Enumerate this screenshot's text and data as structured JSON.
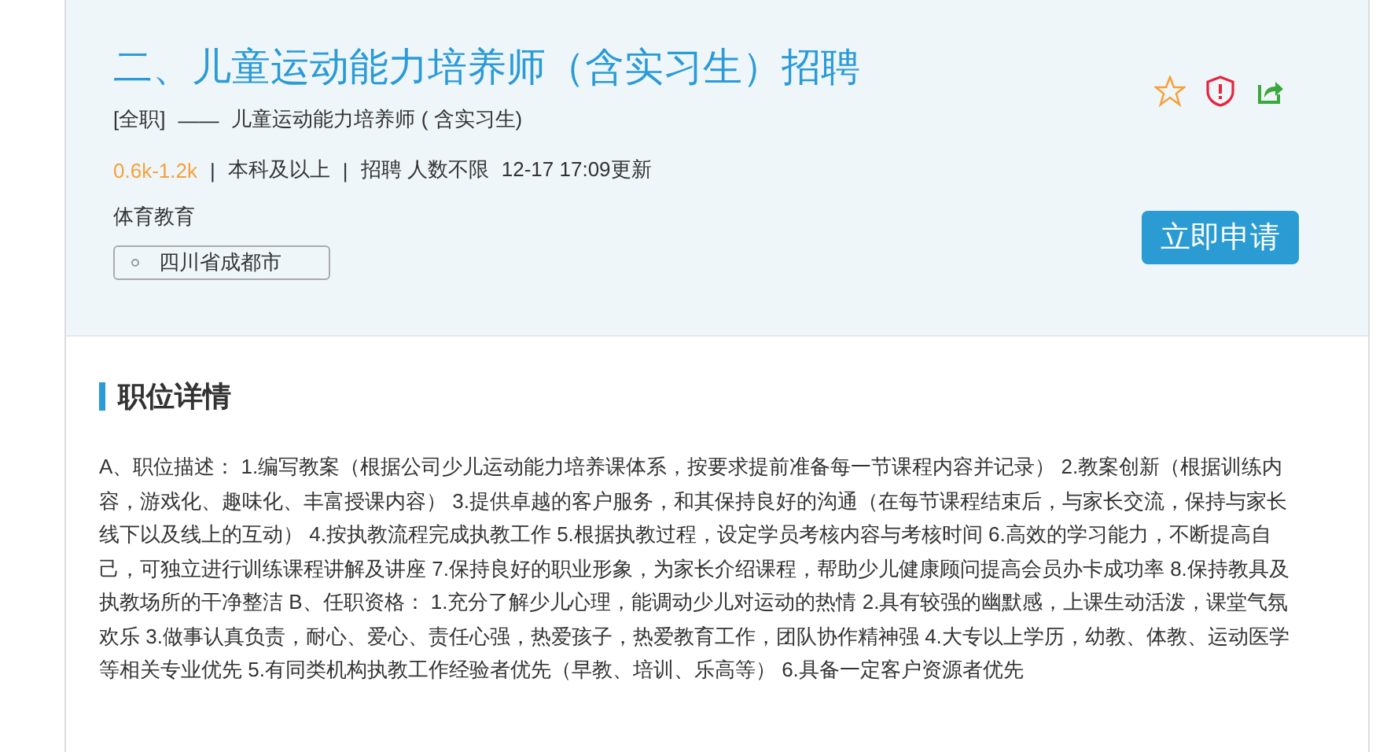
{
  "job": {
    "title": "二、儿童运动能力培养师（含实习生）招聘",
    "type": "[全职]",
    "dash": "——",
    "subtitle": "儿童运动能力培养师 ( 含实习生)",
    "salary": "0.6k-1.2k",
    "separator": "|",
    "education": "本科及以上",
    "headcount": "招聘 人数不限",
    "updated": "12-17 17:09更新",
    "category": "体育教育",
    "location": "四川省成都市",
    "apply": "立即申请",
    "favorited": false
  },
  "details": {
    "heading": "职位详情",
    "text": "A、职位描述： 1.编写教案（根据公司少儿运动能力培养课体系，按要求提前准备每一节课程内容并记录） 2.教案创新（根据训练内容，游戏化、趣味化、丰富授课内容） 3.提供卓越的客户服务，和其保持良好的沟通（在每节课程结束后，与家长交流，保持与家长线下以及线上的互动） 4.按执教流程完成执教工作 5.根据执教过程，设定学员考核内容与考核时间 6.高效的学习能力，不断提高自己，可独立进行训练课程讲解及讲座 7.保持良好的职业形象，为家长介绍课程，帮助少儿健康顾问提高会员办卡成功率 8.保持教具及执教场所的干净整洁 B、任职资格： 1.充分了解少儿心理，能调动少儿对运动的热情 2.具有较强的幽默感，上课生动活泼，课堂气氛欢乐 3.做事认真负责，耐心、爱心、责任心强，热爱孩子，热爱教育工作，团队协作精神强 4.大专以上学历，幼教、体教、运动医学等相关专业优先 5.有同类机构执教工作经验者优先（早教、培训、乐高等） 6.具备一定客户资源者优先"
  }
}
